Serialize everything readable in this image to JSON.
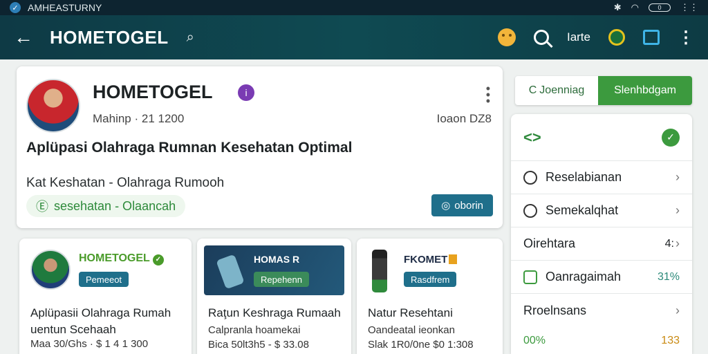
{
  "status_bar": {
    "app_name": "AMHEASTURNY",
    "battery": "0",
    "wifi": "wifi-icon",
    "bluetooth": "bluetooth-icon"
  },
  "app_bar": {
    "title": "HOMETOGEL",
    "action_label": "Iarte"
  },
  "main_card": {
    "title": "HOMETOGEL",
    "verified_glyph": "i",
    "meta_left": "Mahinp · 21 1200",
    "meta_right": "Ioaon DZ8",
    "headline": "Aplüpasi Olahraga Rumnan Kesehatan Optimal",
    "subtitle": "Kat Keshatan - Olahraga Rumooh",
    "tag_text": "sesehatan - Olaancah",
    "button_label": "oborin"
  },
  "segment": {
    "option_a": "Joenniag",
    "option_b": "Slenhbdgam"
  },
  "side_panel": {
    "rows": [
      {
        "label": "Reselabianan",
        "value": ""
      },
      {
        "label": "Semekalqhat",
        "value": ""
      },
      {
        "label": "Oirehtara",
        "value": "4:"
      },
      {
        "label": "Oanragaimah",
        "value": "31%"
      },
      {
        "label": "Rroelnsans",
        "value": ""
      }
    ],
    "footer_left": "00%",
    "footer_right": "133"
  },
  "mini_cards": [
    {
      "brand": "HOMETOGEL",
      "chip": "Pemeeot",
      "title_line1": "Aplüpasii Olahraga Rumah",
      "title_line2": "uentun Scehaah",
      "sub": "Maa 30/Ghs · $ 1 4 1 300"
    },
    {
      "brand": "HOMAS R",
      "chip": "Repehenn",
      "title_line1": "Raţun Keshraga Rumaah",
      "sub_line1": "Calpranla hoamekai",
      "sub_line2": "Bica 50lt3h5 - $ 33.08"
    },
    {
      "brand": "FKOMET",
      "chip": "Rasdfrem",
      "title_line1": "Natur Resehtani",
      "sub_line1": "Oandeatal ieonkan",
      "sub_line2": "Slak 1R0/0ne $0 1:308"
    }
  ]
}
